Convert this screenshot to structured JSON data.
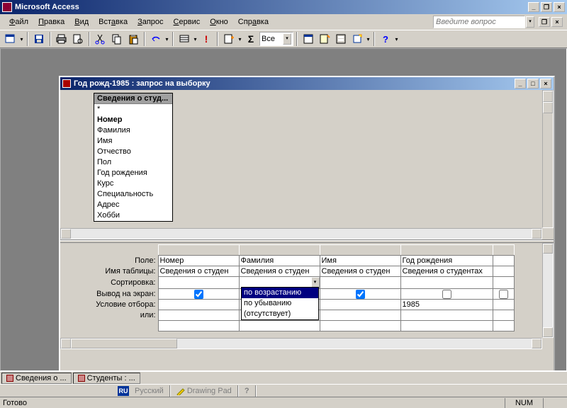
{
  "app": {
    "title": "Microsoft Access"
  },
  "menu": {
    "file": "Файл",
    "edit": "Правка",
    "view": "Вид",
    "insert": "Вставка",
    "query": "Запрос",
    "service": "Сервис",
    "window": "Окно",
    "help": "Справка"
  },
  "question_placeholder": "Введите вопрос",
  "toolbar": {
    "combo_value": "Все"
  },
  "child": {
    "title": "Год рожд-1985 : запрос на выборку"
  },
  "field_list": {
    "title": "Сведения о студ...",
    "items": [
      "*",
      "Номер",
      "Фамилия",
      "Имя",
      "Отчество",
      "Пол",
      "Год рождения",
      "Курс",
      "Специальность",
      "Адрес",
      "Хобби"
    ]
  },
  "grid": {
    "rows": {
      "field": "Поле:",
      "table": "Имя таблицы:",
      "sort": "Сортировка:",
      "show": "Вывод на экран:",
      "criteria": "Условие отбора:",
      "or": "или:"
    },
    "cols": [
      {
        "field": "Номер",
        "table": "Сведения о студен",
        "show": true,
        "criteria": ""
      },
      {
        "field": "Фамилия",
        "table": "Сведения о студен",
        "show": true,
        "criteria": ""
      },
      {
        "field": "Имя",
        "table": "Сведения о студен",
        "show": true,
        "criteria": ""
      },
      {
        "field": "Год рождения",
        "table": "Сведения о студентах",
        "show": false,
        "criteria": "1985"
      }
    ],
    "sort_options": [
      "по возрастанию",
      "по убыванию",
      "(отсутствует)"
    ]
  },
  "windowbar": {
    "item1": "Сведения о ...",
    "item2": "Студенты : ..."
  },
  "taskbar": {
    "lang": "RU",
    "item1": "Русский",
    "item2": "Drawing Pad"
  },
  "status": {
    "ready": "Готово",
    "num": "NUM"
  }
}
